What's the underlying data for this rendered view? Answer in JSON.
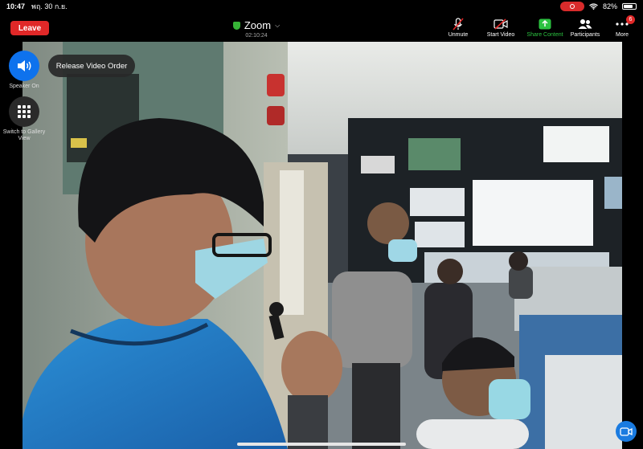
{
  "status_bar": {
    "time": "10:47",
    "date": "พฤ. 30 ก.ย.",
    "battery": "82%"
  },
  "toolbar": {
    "leave_label": "Leave",
    "meeting_title": "Zoom",
    "meeting_timer": "02:10:24",
    "unmute_label": "Unmute",
    "start_video_label": "Start Video",
    "share_content_label": "Share Content",
    "participants_label": "Participants",
    "more_label": "More",
    "more_badge": "6"
  },
  "overlay": {
    "speaker_label": "Speaker On",
    "gallery_label": "Switch to Gallery View",
    "release_label": "Release Video Order"
  },
  "colors": {
    "leave": "#e02828",
    "share_green": "#2bc240",
    "speaker_blue": "#0e72ed",
    "record": "#d92b2b"
  },
  "icons": [
    "speaker-icon",
    "grid-icon",
    "mic-off-icon",
    "video-off-icon",
    "share-icon",
    "participants-icon",
    "more-icon",
    "camera-icon",
    "wifi-icon",
    "battery-icon",
    "shield-icon"
  ]
}
